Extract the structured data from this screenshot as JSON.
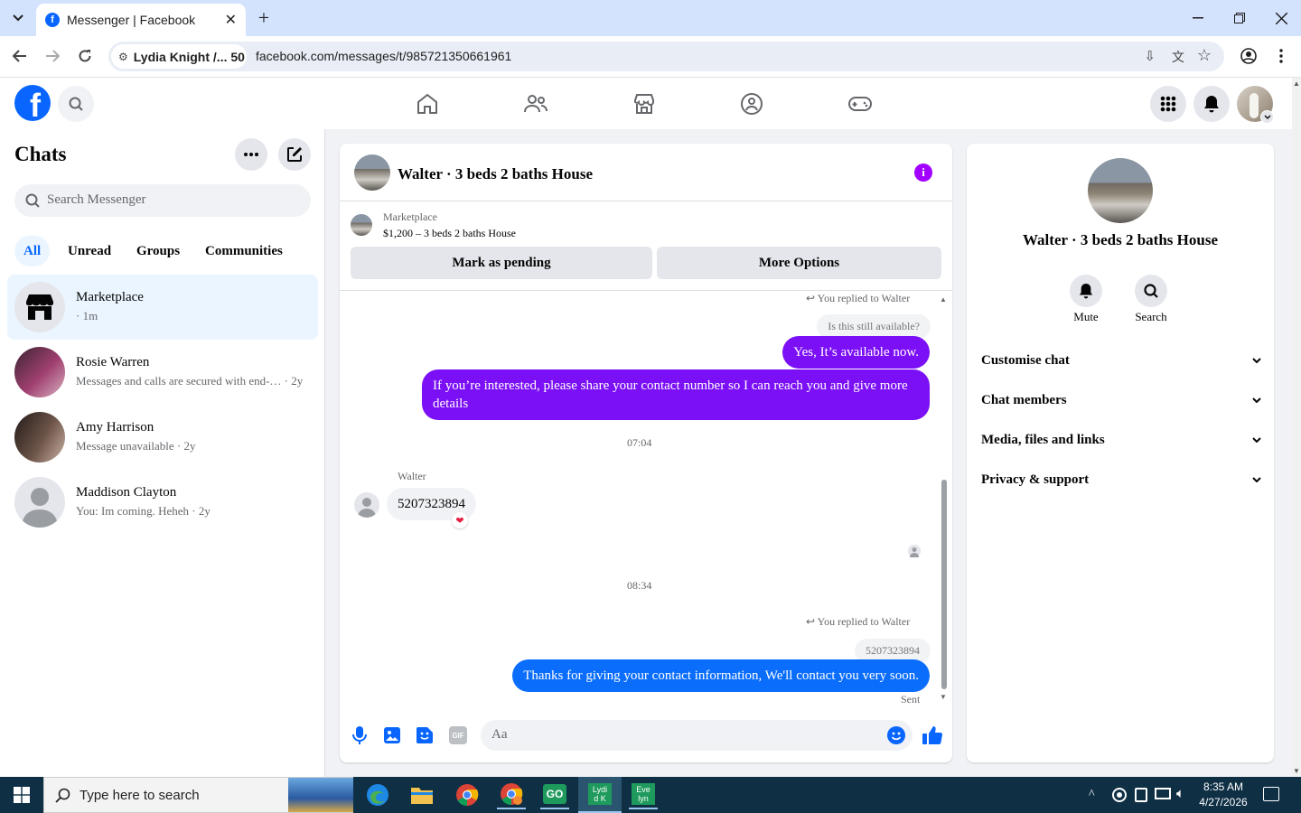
{
  "browser": {
    "tab_title": "Messenger | Facebook",
    "profile_chip": "Lydia Knight /... 50",
    "url": "facebook.com/messages/t/985721350661961"
  },
  "left": {
    "heading": "Chats",
    "search_placeholder": "Search Messenger",
    "filters": [
      "All",
      "Unread",
      "Groups",
      "Communities"
    ],
    "chats": [
      {
        "name": "Marketplace",
        "preview": " · 1m"
      },
      {
        "name": "Rosie Warren",
        "preview": "Messages and calls are secured with end-… · 2y"
      },
      {
        "name": "Amy Harrison",
        "preview": "Message unavailable · 2y"
      },
      {
        "name": "Maddison Clayton",
        "preview": "You: Im coming. Heheh · 2y"
      }
    ]
  },
  "conversation": {
    "title": "Walter · 3 beds 2 baths House",
    "listing_label": "Marketplace",
    "listing_price": "$1,200 – 3 beds 2 baths House",
    "btn_pending": "Mark as pending",
    "btn_more": "More Options",
    "reply_note_1": "You replied to Walter",
    "reply_quote_1": "Is this still available?",
    "msg_1": "Yes, It’s available now.",
    "msg_2": "If you’re interested, please share your contact number so I can reach you and give more details",
    "time_1": "07:04",
    "sender": "Walter",
    "msg_in": "5207323894",
    "time_2": "08:34",
    "reply_note_2": "You replied to Walter",
    "reply_quote_2": "5207323894",
    "msg_3": "Thanks for giving your contact information, We'll contact you very soon.",
    "status": "Sent",
    "composer_placeholder": "Aa"
  },
  "info": {
    "title": "Walter · 3 beds 2 baths House",
    "mute": "Mute",
    "search": "Search",
    "sections": [
      "Customise chat",
      "Chat members",
      "Media, files and links",
      "Privacy & support"
    ]
  },
  "taskbar": {
    "search_placeholder": "Type here to search",
    "time": "8:35 AM",
    "date": "4/27/2026",
    "tile_1": "Lydi\nd K",
    "tile_2": "Eve\nlyn"
  },
  "colors": {
    "fb_blue": "#0866ff",
    "purple_bubble": "#7b0ff5",
    "blue_bubble": "#0a6dfc"
  }
}
